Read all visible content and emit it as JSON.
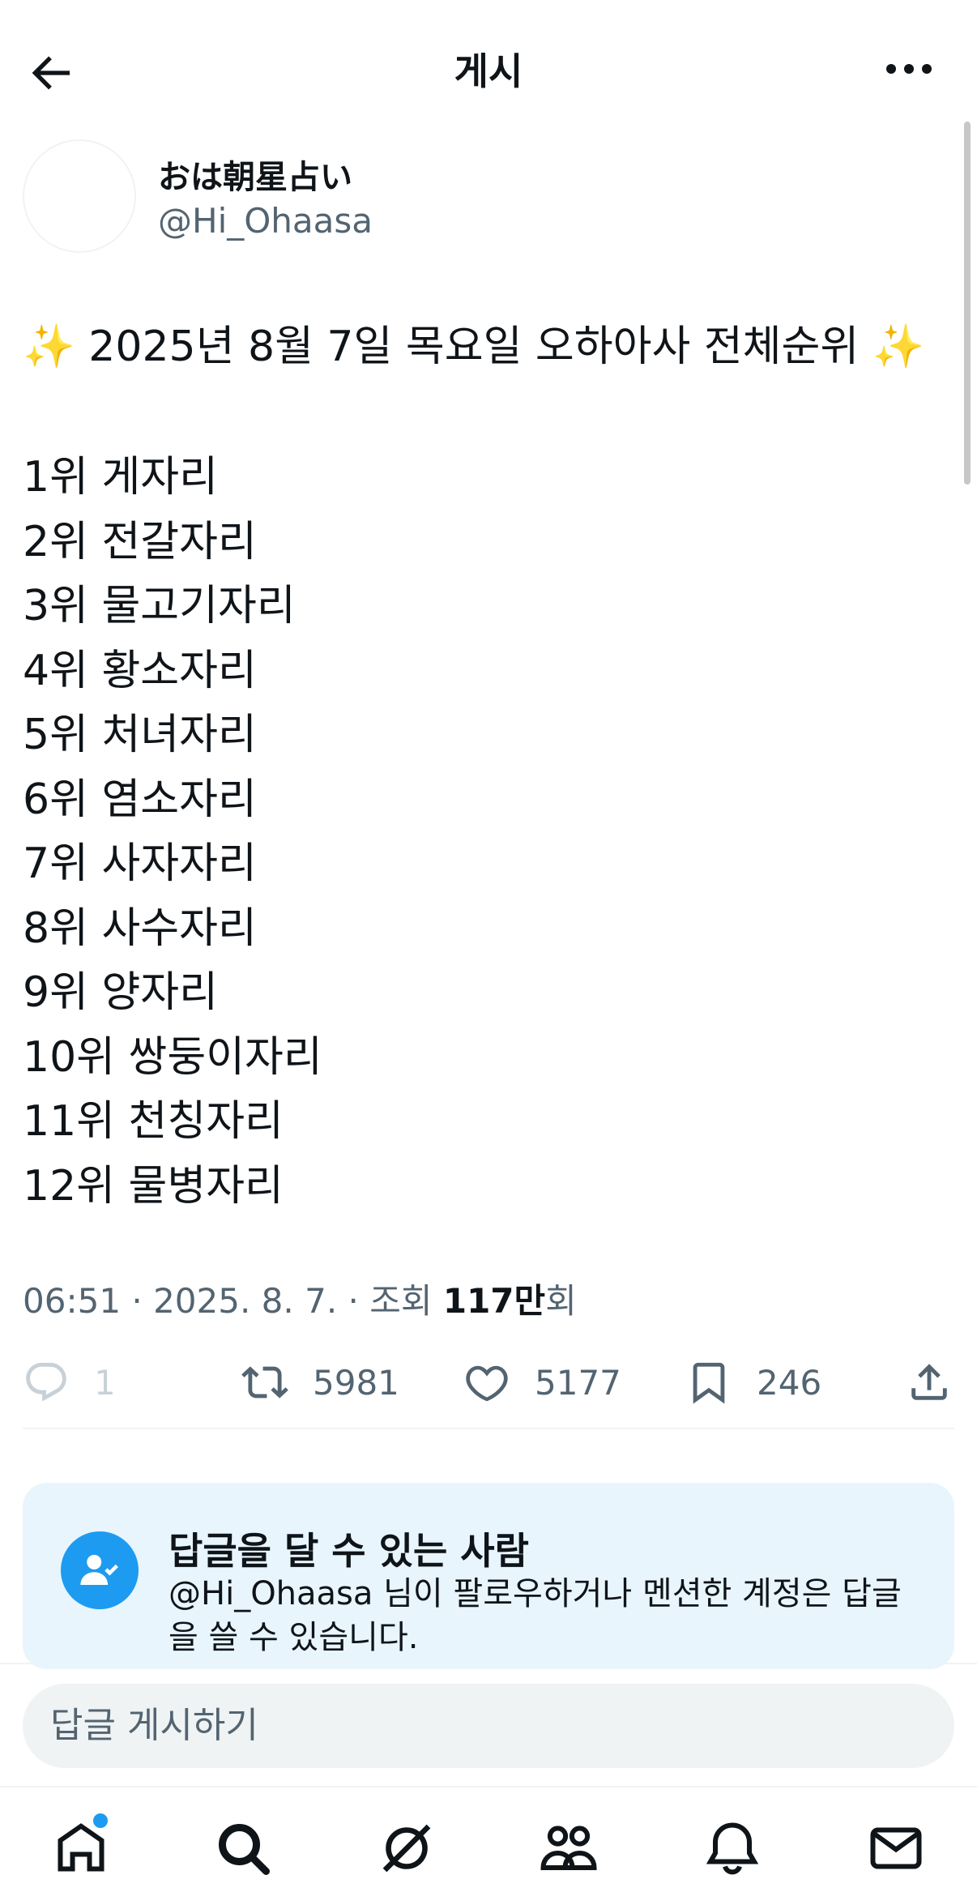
{
  "header": {
    "title": "게시",
    "back_icon": "arrow-left-icon",
    "more_icon": "more-horizontal-icon"
  },
  "author": {
    "name": "おは朝星占い",
    "handle": "@Hi_Ohaasa"
  },
  "post": {
    "headline": "✨ 2025년 8월 7일 목요일 오하아사 전체순위 ✨",
    "ranking": [
      "1위 게자리",
      "2위 전갈자리",
      "3위 물고기자리",
      "4위 황소자리",
      "5위 처녀자리",
      "6위 염소자리",
      "7위 사자자리",
      "8위 사수자리",
      "9위 양자리",
      "10위 쌍둥이자리",
      "11위 천칭자리",
      "12위 물병자리"
    ],
    "meta_prefix": "06:51 · 2025. 8. 7. · 조회 ",
    "views": "117만",
    "views_unit": "회"
  },
  "actions": {
    "replies": "1",
    "reposts": "5981",
    "likes": "5177",
    "bookmarks": "246"
  },
  "reply_restriction": {
    "title": "답글을 달 수 있는 사람",
    "text": "@Hi_Ohaasa 님이 팔로우하거나 멘션한 계정은 답글을 쓸 수 있습니다."
  },
  "composer": {
    "placeholder": "답글 게시하기"
  },
  "nav": [
    "home-icon",
    "search-icon",
    "grok-icon",
    "communities-icon",
    "notifications-icon",
    "messages-icon"
  ],
  "colors": {
    "accent": "#1d9bf0",
    "text": "#0f1419",
    "muted": "#536471",
    "card_bg": "#e8f5fd"
  }
}
